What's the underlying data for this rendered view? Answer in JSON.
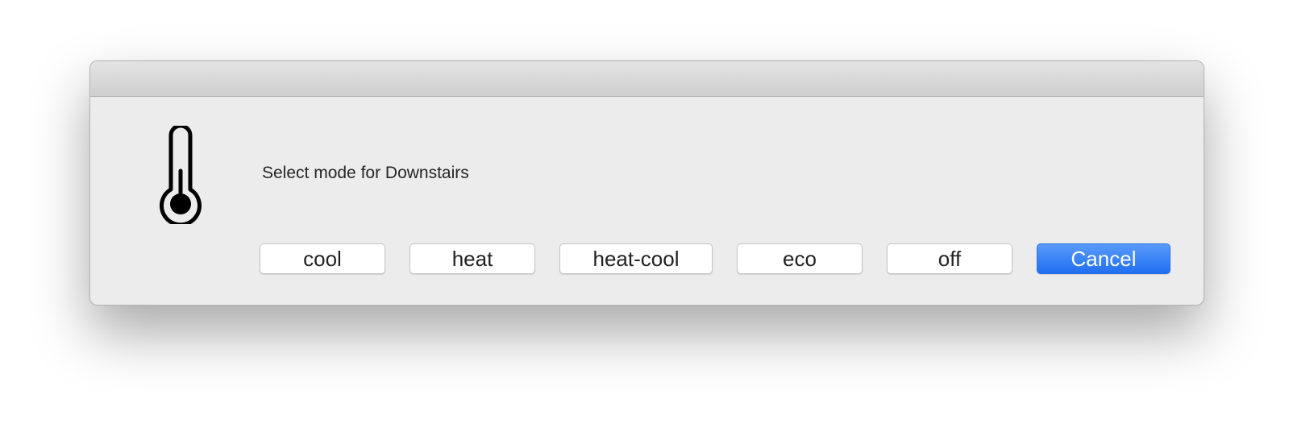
{
  "dialog": {
    "message": "Select mode for Downstairs",
    "icon": "thermometer-icon",
    "buttons": {
      "cool": "cool",
      "heat": "heat",
      "heat_cool": "heat-cool",
      "eco": "eco",
      "off": "off",
      "cancel": "Cancel"
    }
  },
  "colors": {
    "dialog_background": "#ececec",
    "accent": "#2a7af5",
    "button_text": "#222222"
  }
}
